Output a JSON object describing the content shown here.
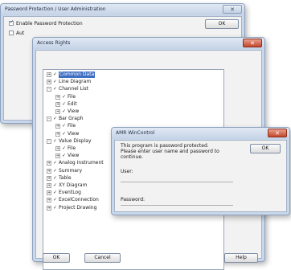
{
  "pp_window": {
    "title": "Password Protection / User Administration",
    "close_glyph": "✕",
    "enable_label": "Enable Password Protection",
    "auto_label": "Aut",
    "ok_label": "OK"
  },
  "access_window": {
    "title": "Access Rights",
    "close_glyph": "✕",
    "tree": [
      {
        "label": "Common Data",
        "expander": "+",
        "level": 0,
        "selected": true
      },
      {
        "label": "Line Diagram",
        "expander": "+",
        "level": 0
      },
      {
        "label": "Channel List",
        "expander": "-",
        "level": 0
      },
      {
        "label": "File",
        "expander": "+",
        "level": 1
      },
      {
        "label": "Edit",
        "expander": "+",
        "level": 1
      },
      {
        "label": "View",
        "expander": "+",
        "level": 1
      },
      {
        "label": "Bar Graph",
        "expander": "-",
        "level": 0
      },
      {
        "label": "File",
        "expander": "+",
        "level": 1
      },
      {
        "label": "View",
        "expander": "+",
        "level": 1
      },
      {
        "label": "Value Display",
        "expander": "-",
        "level": 0
      },
      {
        "label": "File",
        "expander": "+",
        "level": 1
      },
      {
        "label": "View",
        "expander": "+",
        "level": 1
      },
      {
        "label": "Analog Instrument",
        "expander": "+",
        "level": 0
      },
      {
        "label": "Summary",
        "expander": "+",
        "level": 0
      },
      {
        "label": "Table",
        "expander": "+",
        "level": 0
      },
      {
        "label": "XY Diagram",
        "expander": "+",
        "level": 0
      },
      {
        "label": "EventLog",
        "expander": "+",
        "level": 0
      },
      {
        "label": "ExcelConnection",
        "expander": "+",
        "level": 0
      },
      {
        "label": "Project Drawing",
        "expander": "+",
        "level": 0
      }
    ],
    "ok_label": "OK",
    "cancel_label": "Cancel",
    "help_label": "Help"
  },
  "login_dialog": {
    "title": "AMR WinControl",
    "close_glyph": "✕",
    "message_line1": "This program is password protected.",
    "message_line2": "Please enter user name and password to",
    "message_line3": "continue.",
    "user_label": "User:",
    "password_label": "Password:",
    "ok_label": "OK"
  }
}
